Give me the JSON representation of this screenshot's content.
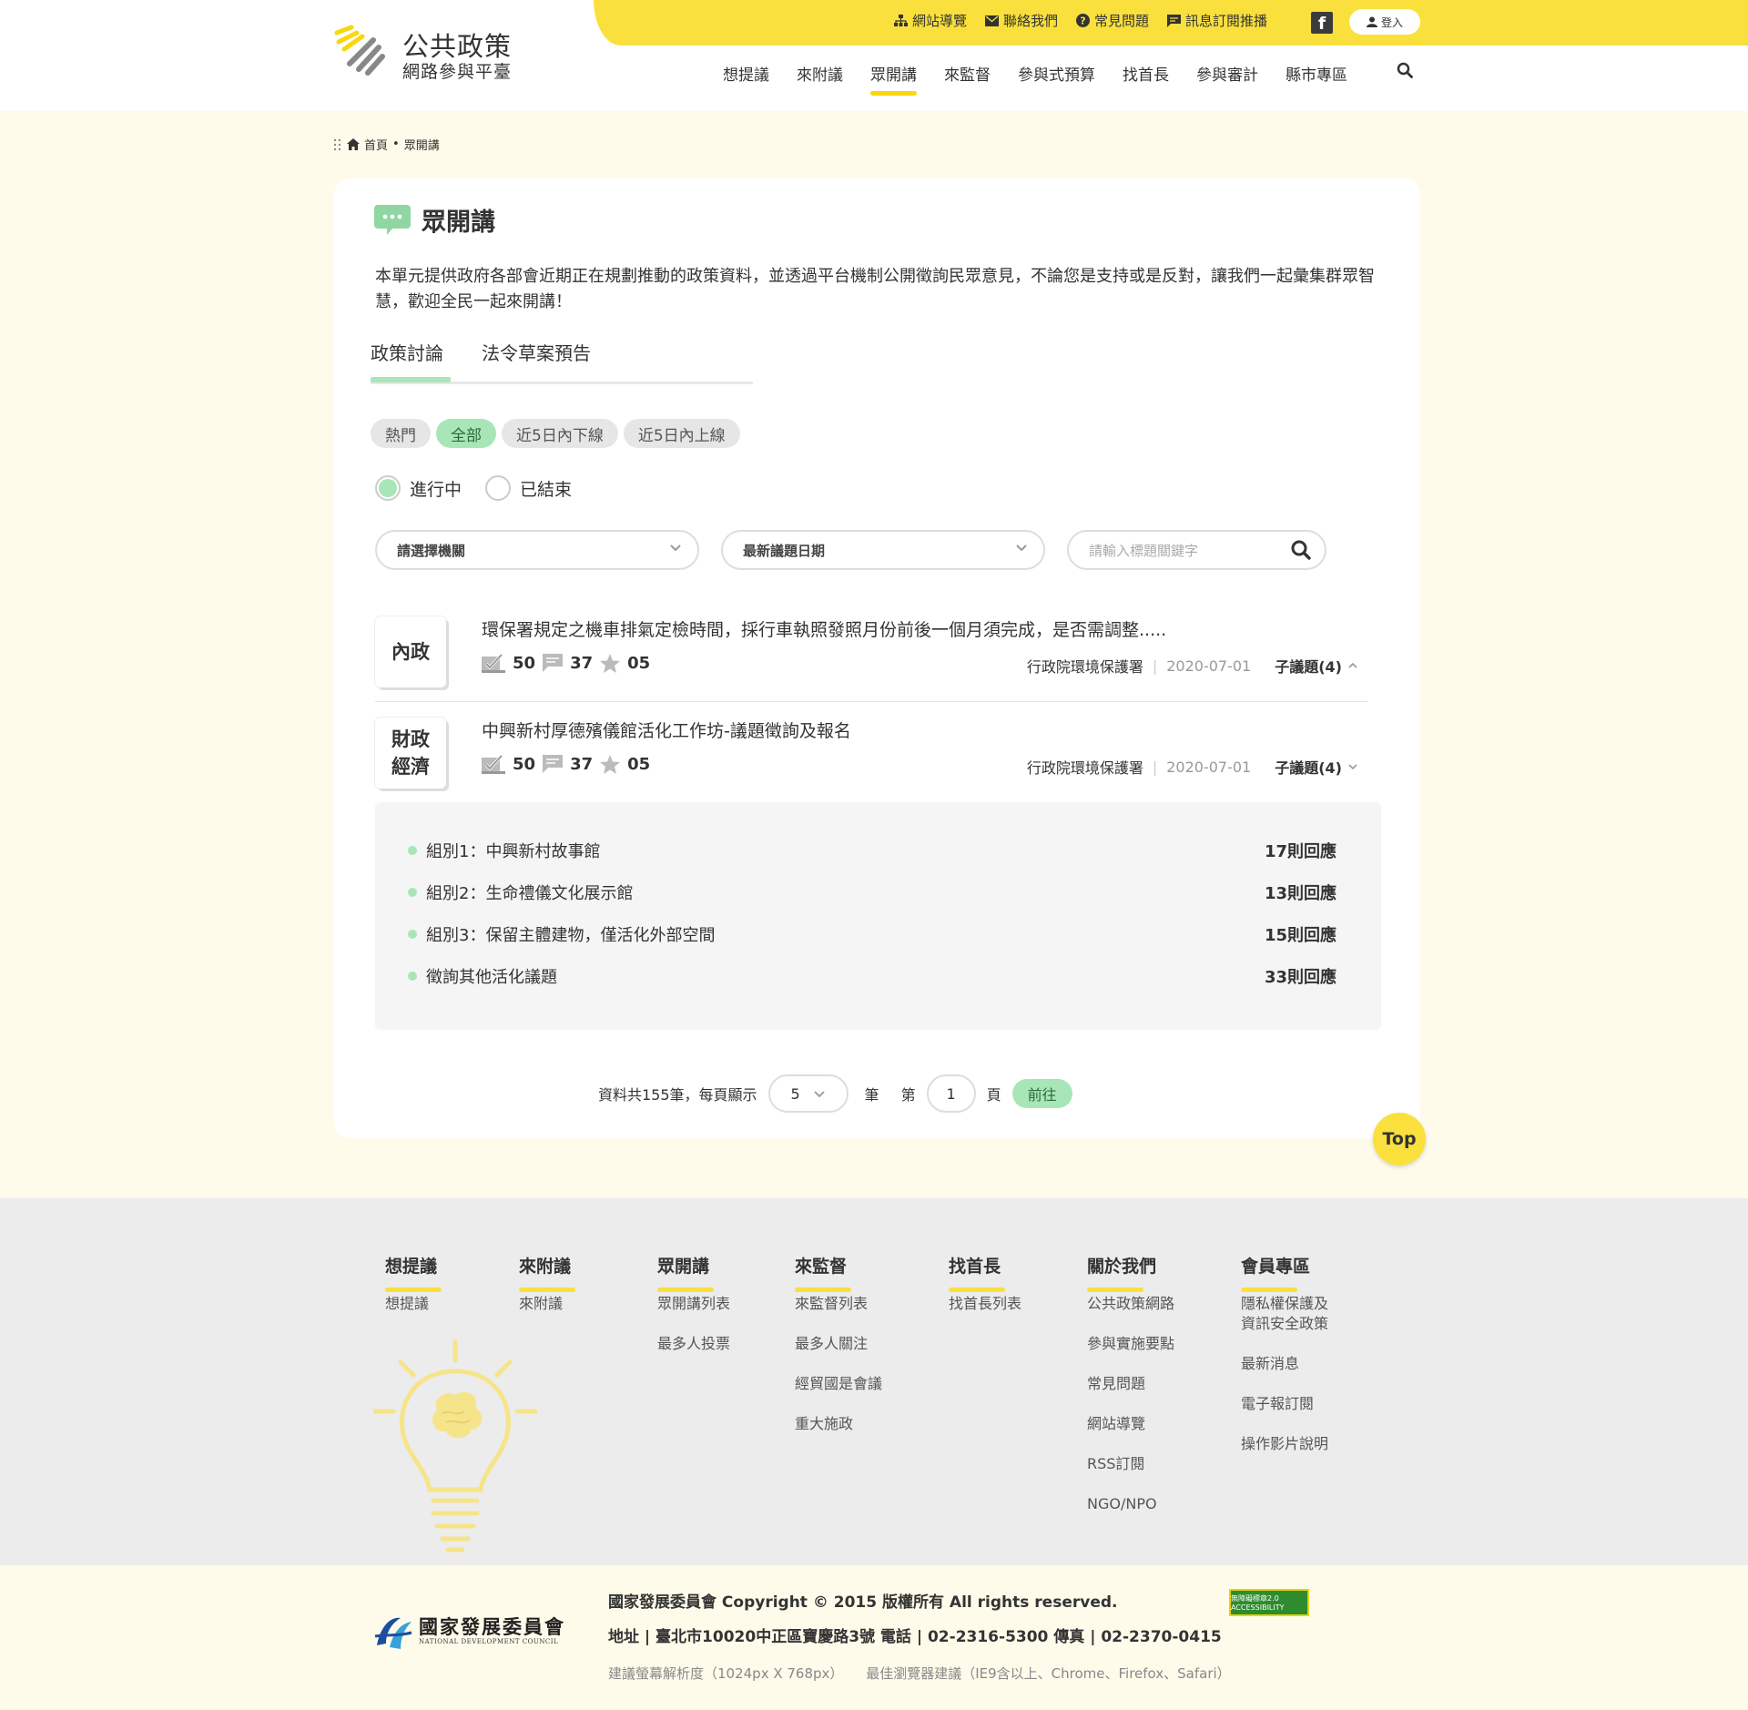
{
  "header": {
    "logo_title": "公共政策",
    "logo_subtitle": "網路參與平臺",
    "top_links": [
      {
        "label": "網站導覽",
        "icon": "sitemap-icon"
      },
      {
        "label": "聯絡我們",
        "icon": "mail-icon"
      },
      {
        "label": "常見問題",
        "icon": "question-icon"
      },
      {
        "label": "訊息訂閱推播",
        "icon": "message-icon"
      }
    ],
    "facebook": "f",
    "login_label": "登入",
    "nav": [
      "想提議",
      "來附議",
      "眾開講",
      "來監督",
      "參與式預算",
      "找首長",
      "參與審計",
      "縣市專區"
    ],
    "active_nav": "眾開講",
    "accent_color": "#f9e03c"
  },
  "breadcrumb": {
    "home": "首頁",
    "sep": "•",
    "current": "眾開講"
  },
  "page": {
    "title": "眾開講",
    "intro": "本單元提供政府各部會近期正在規劃推動的政策資料，並透過平台機制公開徵詢民眾意見，不論您是支持或是反對，讓我們一起彙集群眾智慧，歡迎全民一起來開講！",
    "tabs": [
      "政策討論",
      "法令草案預告"
    ],
    "filters": [
      "熱門",
      "全部",
      "近5日內下線",
      "近5日內上線"
    ],
    "active_filter": "全部",
    "radios": [
      "進行中",
      "已結束"
    ],
    "selected_radio": "進行中",
    "select_agency": "請選擇機關",
    "select_sort": "最新議題日期",
    "search_placeholder": "請輸入標題關鍵字",
    "green_color": "#a8e6b7"
  },
  "topics": [
    {
      "category": "內政",
      "title": "環保署規定之機車排氣定檢時間，採行車執照發照月份前後一個月須完成，是否需調整.....",
      "votes": "50",
      "comments": "37",
      "stars": "05",
      "agency": "行政院環境保護署",
      "date": "2020-07-01",
      "sub_label": "子議題(4)"
    },
    {
      "category": "財政經濟",
      "category_line1": "財政",
      "category_line2": "經濟",
      "title": "中興新村厚德殯儀館活化工作坊-議題徵詢及報名",
      "votes": "50",
      "comments": "37",
      "stars": "05",
      "agency": "行政院環境保護署",
      "date": "2020-07-01",
      "sub_label": "子議題(4)"
    }
  ],
  "subtopics": [
    {
      "name": "組別1：中興新村故事館",
      "count": "17則回應"
    },
    {
      "name": "組別2：生命禮儀文化展示館",
      "count": "13則回應"
    },
    {
      "name": "組別3：保留主體建物，僅活化外部空間",
      "count": "15則回應"
    },
    {
      "name": "徵詢其他活化議題",
      "count": "33則回應"
    }
  ],
  "pager": {
    "total_text": "資料共155筆，每頁顯示",
    "per_page": "5",
    "unit": "筆",
    "page_prefix": "第",
    "page": "1",
    "page_suffix": "頁",
    "go": "前往"
  },
  "top_button": "Top",
  "footer": {
    "columns": [
      {
        "heading": "想提議",
        "items": [
          "想提議"
        ]
      },
      {
        "heading": "來附議",
        "items": [
          "來附議"
        ]
      },
      {
        "heading": "眾開講",
        "items": [
          "眾開講列表",
          "最多人投票"
        ]
      },
      {
        "heading": "來監督",
        "items": [
          "來監督列表",
          "最多人關注",
          "經貿國是會議",
          "重大施政"
        ]
      },
      {
        "heading": "找首長",
        "items": [
          "找首長列表"
        ]
      },
      {
        "heading": "關於我們",
        "items": [
          "公共政策網路",
          "參與實施要點",
          "常見問題",
          "網站導覽",
          "RSS訂閱",
          "NGO/NPO"
        ]
      },
      {
        "heading": "會員專區",
        "items": [
          "隱私權保護及\n資訊安全政策",
          "最新消息",
          "電子報訂閱",
          "操作影片說明"
        ]
      }
    ],
    "org_cn": "國家發展委員會",
    "org_en": "NATIONAL DEVELOPMENT COUNCIL",
    "copyright": "國家發展委員會 Copyright © 2015 版權所有 All rights reserved.",
    "address": "地址 | 臺北市10020中正區寶慶路3號 電話 | 02-2316-5300 傳真 | 02-2370-0415",
    "resolution": "建議螢幕解析度（1024px X 768px）",
    "browser": "最佳瀏覽器建議（IE9含以上、Chrome、Firefox、Safari）",
    "accessibility": "無障礙標章2.0 ACCESSIBILITY"
  }
}
